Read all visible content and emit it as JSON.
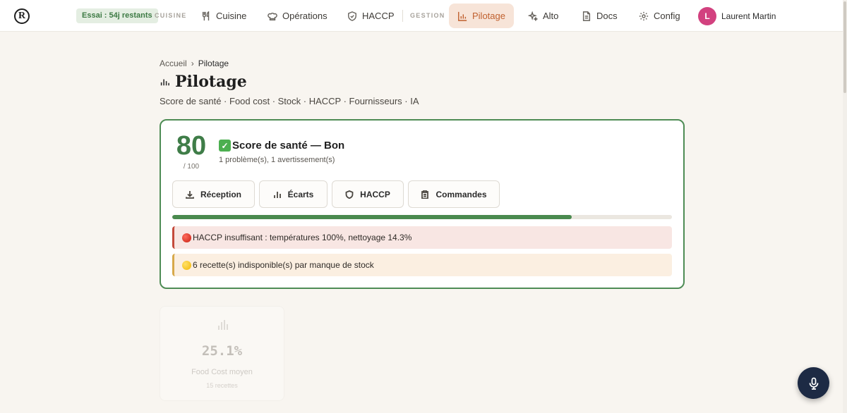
{
  "app": {
    "logo_letter": "R"
  },
  "topbar": {
    "trial_badge": "Essai : 54j restants",
    "section_cuisine": "CUISINE",
    "section_gestion": "GESTION",
    "nav": {
      "cuisine": "Cuisine",
      "operations": "Opérations",
      "haccp": "HACCP",
      "pilotage": "Pilotage",
      "alto": "Alto",
      "docs": "Docs",
      "config": "Config"
    },
    "active_item": "pilotage",
    "user": {
      "initial": "L",
      "name": "Laurent Martin",
      "avatar_color": "#d2417f"
    }
  },
  "breadcrumb": {
    "home": "Accueil",
    "separator": "›",
    "current": "Pilotage"
  },
  "page": {
    "title": "Pilotage",
    "subtitle": "Score de santé · Food cost · Stock · HACCP · Fournisseurs · IA"
  },
  "health": {
    "score": "80",
    "max": "/ 100",
    "status": "Score de santé — Bon",
    "detail": "1 problème(s), 1 avertissement(s)",
    "progress_fraction": 0.8,
    "accent_color": "#4e8c55",
    "quick_actions": {
      "reception": "Réception",
      "ecarts": "Écarts",
      "haccp": "HACCP",
      "commandes": "Commandes"
    },
    "alerts": [
      {
        "level": "problem",
        "icon": "red-circle-icon",
        "text": "HACCP insuffisant : températures 100%, nettoyage 14.3%"
      },
      {
        "level": "warning",
        "icon": "yellow-circle-icon",
        "text": "6 recette(s) indisponible(s) par manque de stock"
      }
    ]
  },
  "food_cost_tile": {
    "value": "25.1%",
    "label": "Food Cost moyen",
    "sub": "15 recettes"
  }
}
